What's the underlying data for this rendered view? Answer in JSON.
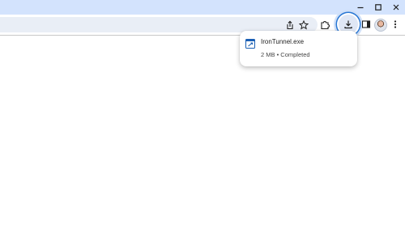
{
  "window": {
    "controls": [
      "minimize",
      "maximize",
      "close"
    ]
  },
  "toolbar": {
    "icons": {
      "share": "share-icon",
      "bookmark": "star-icon",
      "extensions": "puzzle-icon",
      "downloads": "download-icon",
      "side_panel": "side-panel-icon",
      "profile": "avatar",
      "menu": "kebab-menu-icon"
    }
  },
  "download_popup": {
    "file_name": "IronTunnel.exe",
    "status": "2 MB • Completed",
    "file_icon": "exe-file-icon"
  },
  "colors": {
    "titlebar": "#d3e3fd",
    "omnibox": "#e9eef6",
    "accent": "#2a78d4"
  }
}
